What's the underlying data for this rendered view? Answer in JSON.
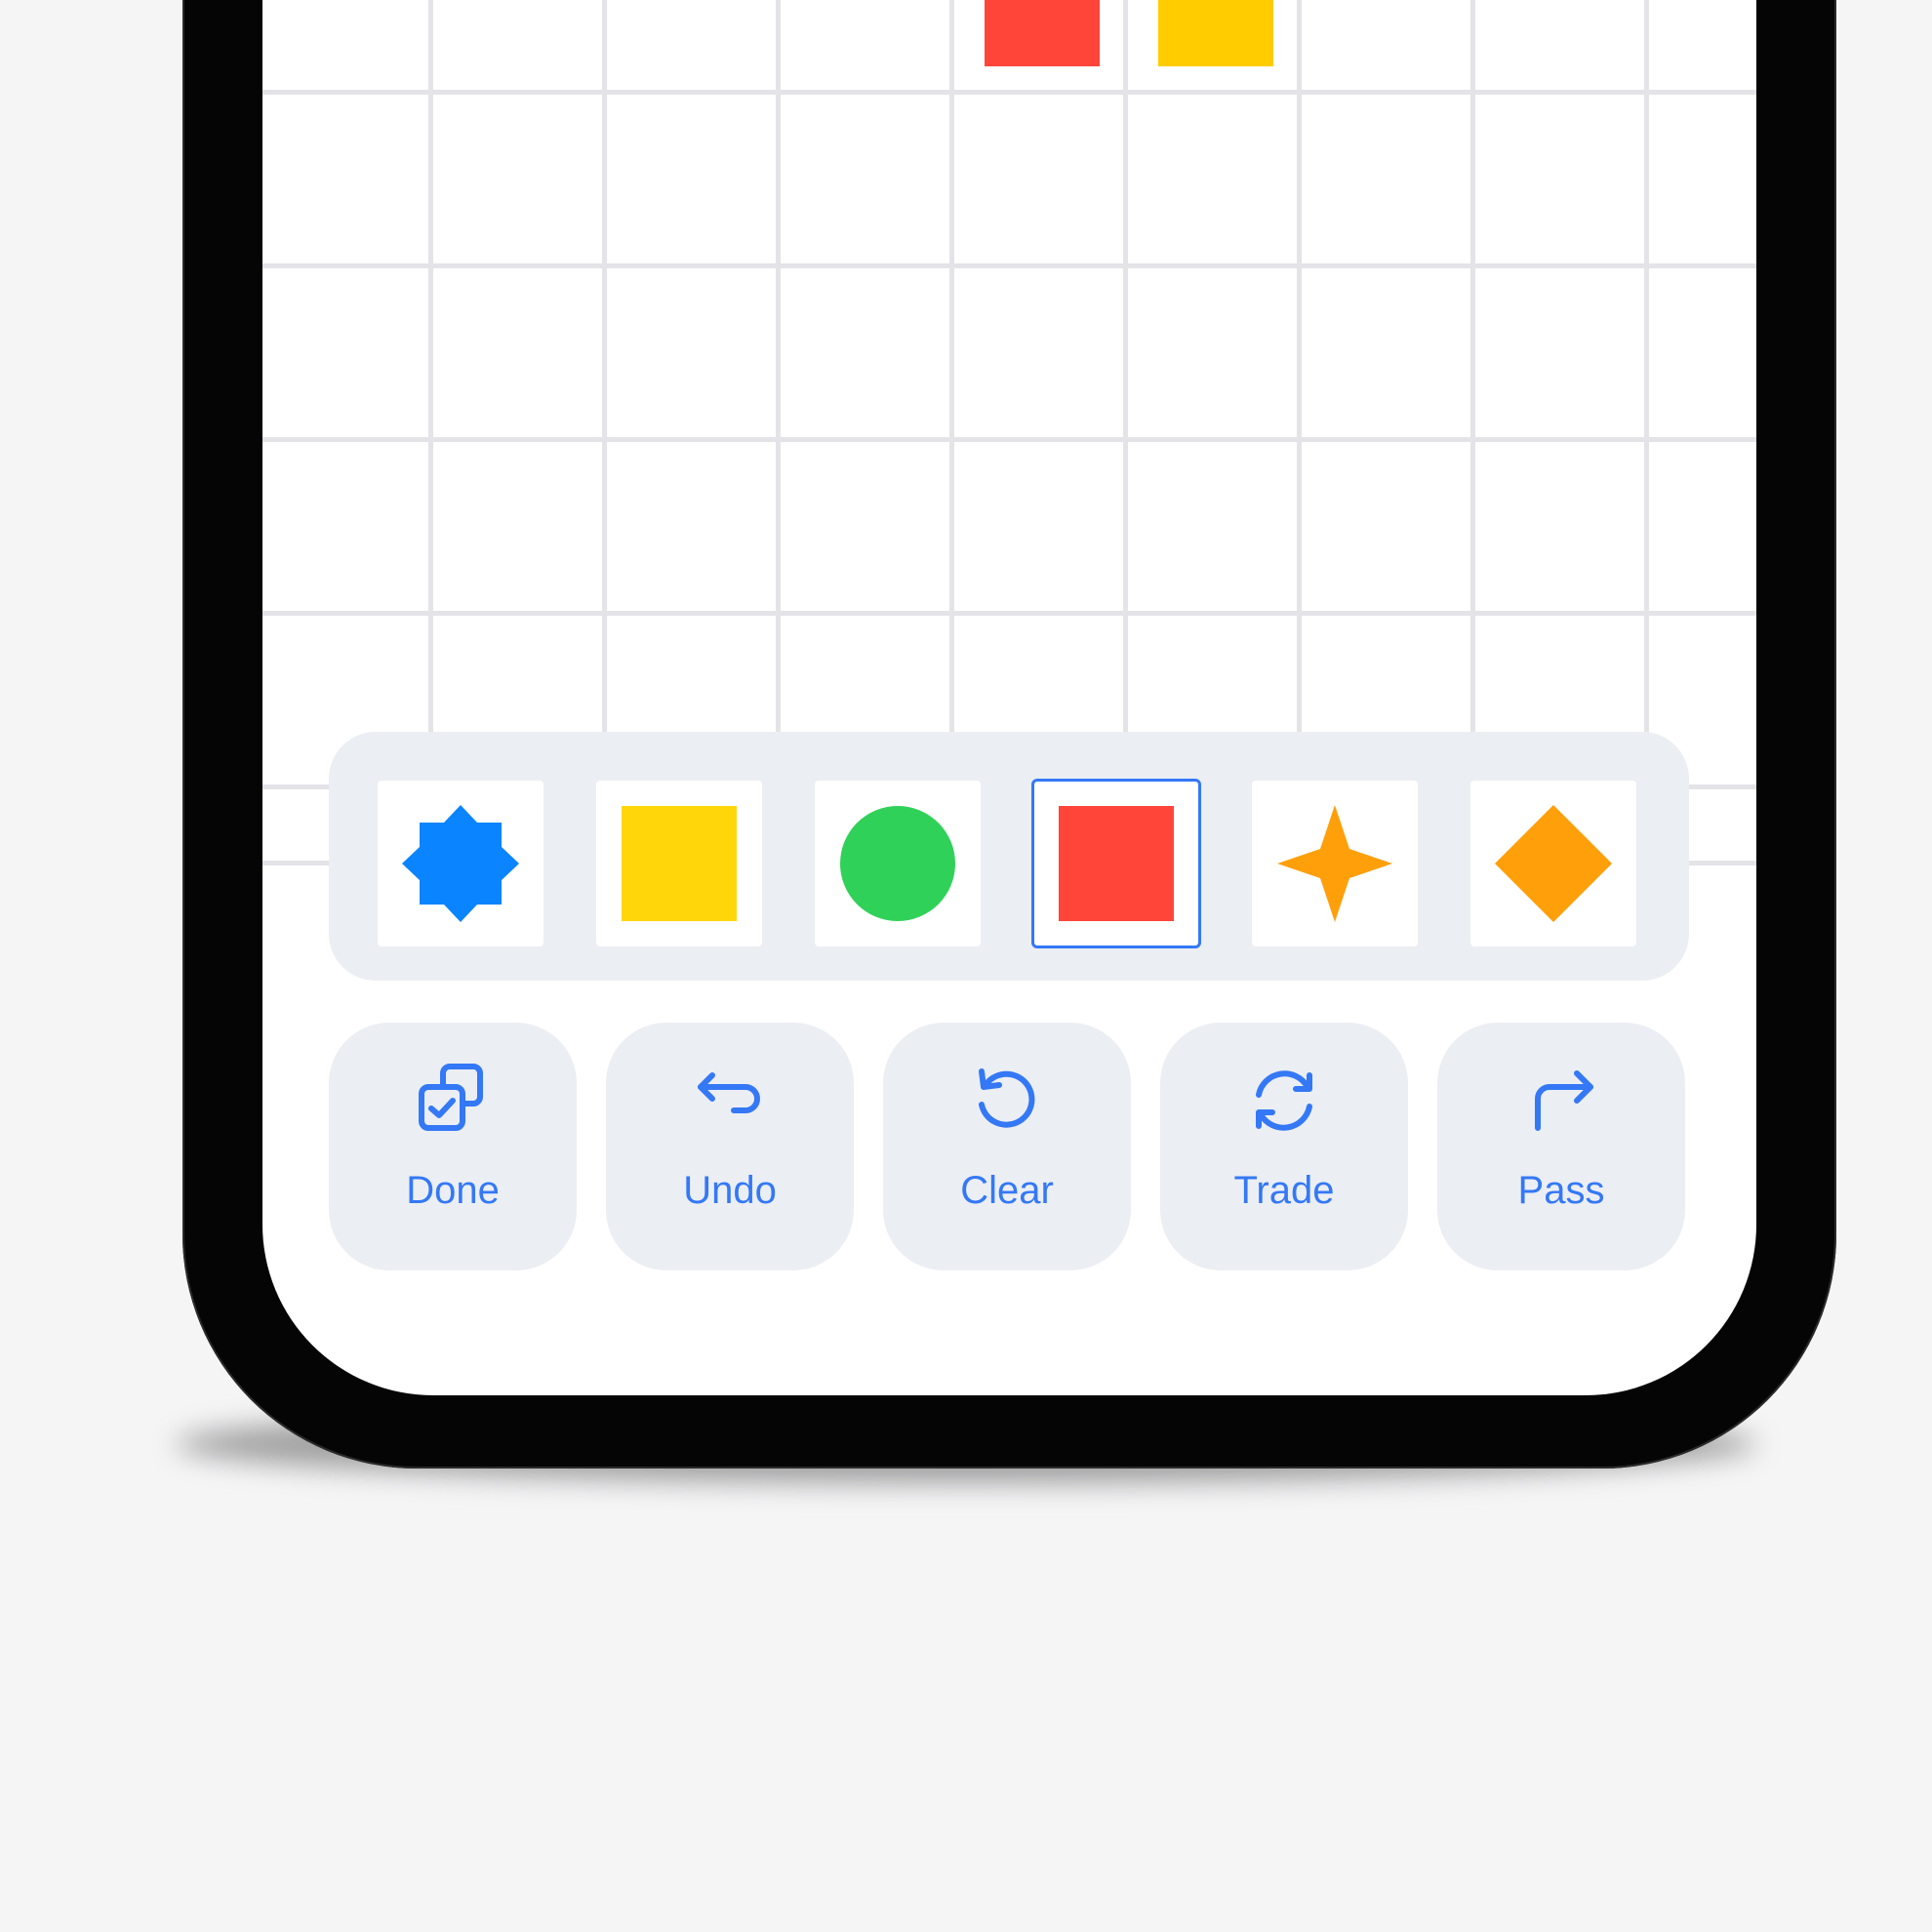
{
  "tray": {
    "tiles": [
      {
        "shape": "eight-point-star",
        "color": "#0a84ff",
        "selected": false
      },
      {
        "shape": "square",
        "color": "#ffd60a",
        "selected": false
      },
      {
        "shape": "circle",
        "color": "#30d158",
        "selected": false
      },
      {
        "shape": "square",
        "color": "#ff453a",
        "selected": true
      },
      {
        "shape": "four-point-star",
        "color": "#ff9f0a",
        "selected": false
      },
      {
        "shape": "diamond",
        "color": "#ff9f0a",
        "selected": false
      }
    ]
  },
  "board": {
    "placed_tiles": [
      {
        "shape": "square",
        "color": "#ff453a"
      },
      {
        "shape": "square",
        "color": "#ffcc00"
      }
    ]
  },
  "actions": {
    "done": {
      "label": "Done",
      "icon": "done-icon"
    },
    "undo": {
      "label": "Undo",
      "icon": "undo-icon"
    },
    "clear": {
      "label": "Clear",
      "icon": "clear-icon"
    },
    "trade": {
      "label": "Trade",
      "icon": "trade-icon"
    },
    "pass": {
      "label": "Pass",
      "icon": "pass-icon"
    }
  },
  "colors": {
    "accent": "#3478f6",
    "grid": "#e3e3e8",
    "panel": "#ebeef3"
  }
}
